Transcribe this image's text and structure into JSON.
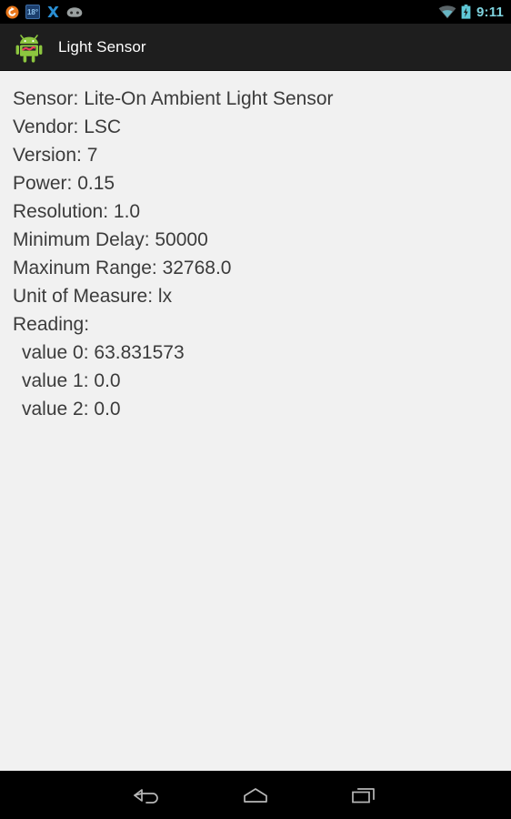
{
  "status_bar": {
    "icons_left": [
      {
        "name": "sync-circle-icon",
        "label": "",
        "color": "#e8761a"
      },
      {
        "name": "weather-temperature-icon",
        "label": "18°",
        "color": "#1c3f6e"
      },
      {
        "name": "xbmc-x-icon",
        "label": "",
        "color": "#2a8fd4"
      },
      {
        "name": "cyanogenmod-head-icon",
        "label": "",
        "color": "#9aa0a0"
      }
    ],
    "icons_right": [
      {
        "name": "wifi-icon",
        "label": "",
        "color": "#6f7c80"
      },
      {
        "name": "battery-charging-icon",
        "label": "",
        "color": "#5fc9d8"
      }
    ],
    "clock": "9:11",
    "clock_color": "#7fd4e0"
  },
  "action_bar": {
    "app_icon_name": "android-robot-icon",
    "title": "Light Sensor",
    "background": "#1e1e1e",
    "title_color": "#ffffff"
  },
  "content": {
    "background": "#f1f1f1",
    "text_color": "#3b3b3b",
    "lines": [
      {
        "text": "Sensor: Lite-On Ambient Light Sensor",
        "indented": false
      },
      {
        "text": "Vendor: LSC",
        "indented": false
      },
      {
        "text": "Version: 7",
        "indented": false
      },
      {
        "text": "Power: 0.15",
        "indented": false
      },
      {
        "text": "Resolution: 1.0",
        "indented": false
      },
      {
        "text": "Minimum Delay: 50000",
        "indented": false
      },
      {
        "text": "Maxinum Range: 32768.0",
        "indented": false
      },
      {
        "text": "Unit of Measure: lx",
        "indented": false
      },
      {
        "text": "Reading:",
        "indented": false
      },
      {
        "text": "value 0: 63.831573",
        "indented": true
      },
      {
        "text": "value 1: 0.0",
        "indented": true
      },
      {
        "text": "value 2: 0.0",
        "indented": true
      }
    ],
    "fields": {
      "sensor": "Lite-On Ambient Light Sensor",
      "vendor": "LSC",
      "version": "7",
      "power": "0.15",
      "resolution": "1.0",
      "minimum_delay": "50000",
      "maxinum_range": "32768.0",
      "unit_of_measure": "lx",
      "reading_value_0": "63.831573",
      "reading_value_1": "0.0",
      "reading_value_2": "0.0"
    }
  },
  "nav_bar": {
    "background": "#000000",
    "buttons": [
      {
        "name": "back-button",
        "icon": "back-arrow-icon"
      },
      {
        "name": "home-button",
        "icon": "home-icon"
      },
      {
        "name": "recents-button",
        "icon": "recents-icon"
      }
    ]
  }
}
